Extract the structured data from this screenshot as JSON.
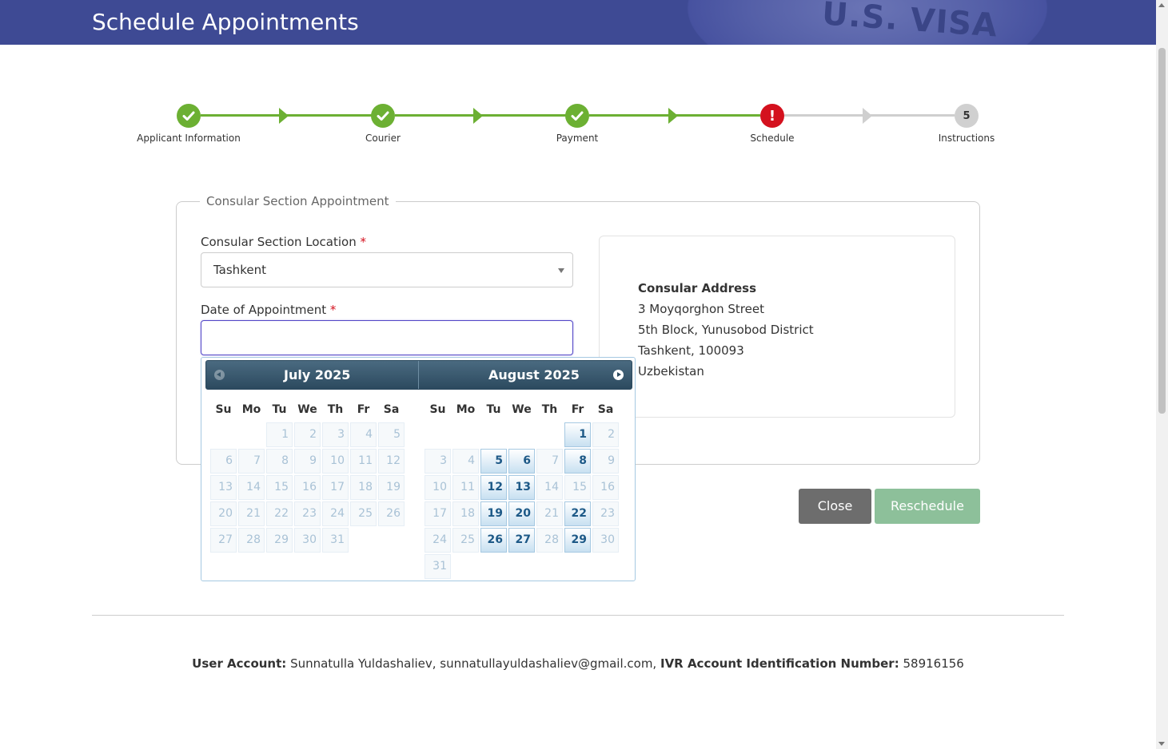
{
  "header": {
    "title": "Schedule Appointments",
    "seal_text": "U.S. VISA"
  },
  "steps": [
    {
      "label": "Applicant Information",
      "state": "done"
    },
    {
      "label": "Courier",
      "state": "done"
    },
    {
      "label": "Payment",
      "state": "done"
    },
    {
      "label": "Schedule",
      "state": "error",
      "mark": "!"
    },
    {
      "label": "Instructions",
      "state": "todo",
      "number": "5"
    }
  ],
  "form": {
    "legend": "Consular Section Appointment",
    "location_label": "Consular Section Location",
    "required_mark": "*",
    "location_value": "Tashkent",
    "date_label": "Date of Appointment",
    "date_value": ""
  },
  "address": {
    "heading": "Consular Address",
    "line1": "3 Moyqorghon Street",
    "line2": "5th Block, Yunusobod District",
    "line3": "Tashkent, 100093",
    "line4": "Uzbekistan"
  },
  "buttons": {
    "close": "Close",
    "reschedule": "Reschedule"
  },
  "datepicker": {
    "weekdays": [
      "Su",
      "Mo",
      "Tu",
      "We",
      "Th",
      "Fr",
      "Sa"
    ],
    "months": [
      {
        "title": "July 2025",
        "first_weekday": 2,
        "days": 31,
        "available": []
      },
      {
        "title": "August 2025",
        "first_weekday": 5,
        "days": 31,
        "available": [
          1,
          5,
          6,
          8,
          12,
          13,
          19,
          20,
          22,
          26,
          27,
          29
        ]
      }
    ]
  },
  "footer": {
    "account_label": "User Account:",
    "account_value": "Sunnatulla Yuldashaliev, sunnatullayuldashaliev@gmail.com,",
    "ivr_label": "IVR Account Identification Number:",
    "ivr_value": "58916156"
  },
  "colors": {
    "header_bg": "#3e4a94",
    "done": "#6cb033",
    "error": "#d4111e",
    "reschedule_bg": "#8dc09a"
  }
}
